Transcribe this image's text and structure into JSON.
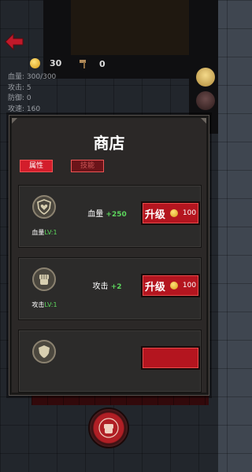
{
  "hud": {
    "coins": "30",
    "resource2": "0",
    "stats": [
      "血量: 300/300",
      "攻击: 5",
      "防御: 0",
      "攻速: 160"
    ]
  },
  "shop": {
    "title": "商店",
    "tabs": [
      {
        "label": "属性",
        "active": true
      },
      {
        "label": "技能",
        "active": false
      }
    ],
    "items": [
      {
        "icon": "heart-shield-icon",
        "level_prefix": "血量",
        "level": "LV:1",
        "stat_name": "血量",
        "stat_bonus": "+250",
        "button_label": "升级",
        "cost": "100"
      },
      {
        "icon": "fist-icon",
        "level_prefix": "攻击",
        "level": "LV:1",
        "stat_name": "攻击",
        "stat_bonus": "+2",
        "button_label": "升级",
        "cost": "100"
      },
      {
        "icon": "shield-icon",
        "level_prefix": "",
        "level": "",
        "stat_name": "",
        "stat_bonus": "",
        "button_label": "",
        "cost": ""
      }
    ]
  },
  "colors": {
    "accent_red": "#b4151f",
    "bonus_green": "#5cd65c",
    "coin_gold": "#e0a91c"
  }
}
